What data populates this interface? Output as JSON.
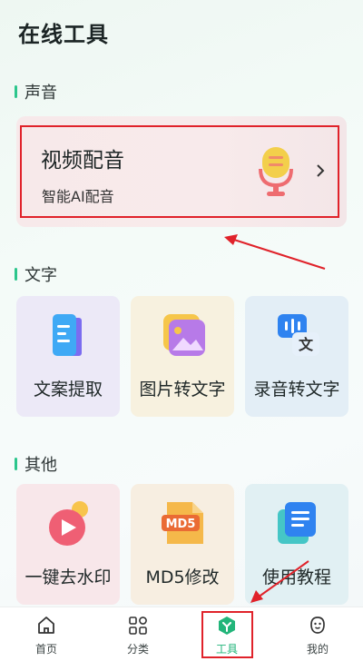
{
  "page": {
    "title": "在线工具"
  },
  "sections": {
    "voice": {
      "title": "声音"
    },
    "text": {
      "title": "文字"
    },
    "other": {
      "title": "其他"
    }
  },
  "voice_card": {
    "title": "视频配音",
    "subtitle": "智能AI配音"
  },
  "text_tools": [
    {
      "label": "文案提取",
      "icon": "document-extract-icon"
    },
    {
      "label": "图片转文字",
      "icon": "image-icon"
    },
    {
      "label": "录音转文字",
      "icon": "audio-to-text-icon"
    }
  ],
  "other_tools": [
    {
      "label": "一键去水印",
      "icon": "play-watermark-icon"
    },
    {
      "label": "MD5修改",
      "icon": "md5-file-icon",
      "badge": "MD5"
    },
    {
      "label": "使用教程",
      "icon": "tutorial-doc-icon"
    }
  ],
  "tabbar": [
    {
      "label": "首页",
      "icon": "home-icon"
    },
    {
      "label": "分类",
      "icon": "category-icon"
    },
    {
      "label": "工具",
      "icon": "tools-icon",
      "active": true
    },
    {
      "label": "我的",
      "icon": "profile-icon"
    }
  ],
  "colors": {
    "accent": "#22b57a",
    "annotation": "#e0222a"
  }
}
